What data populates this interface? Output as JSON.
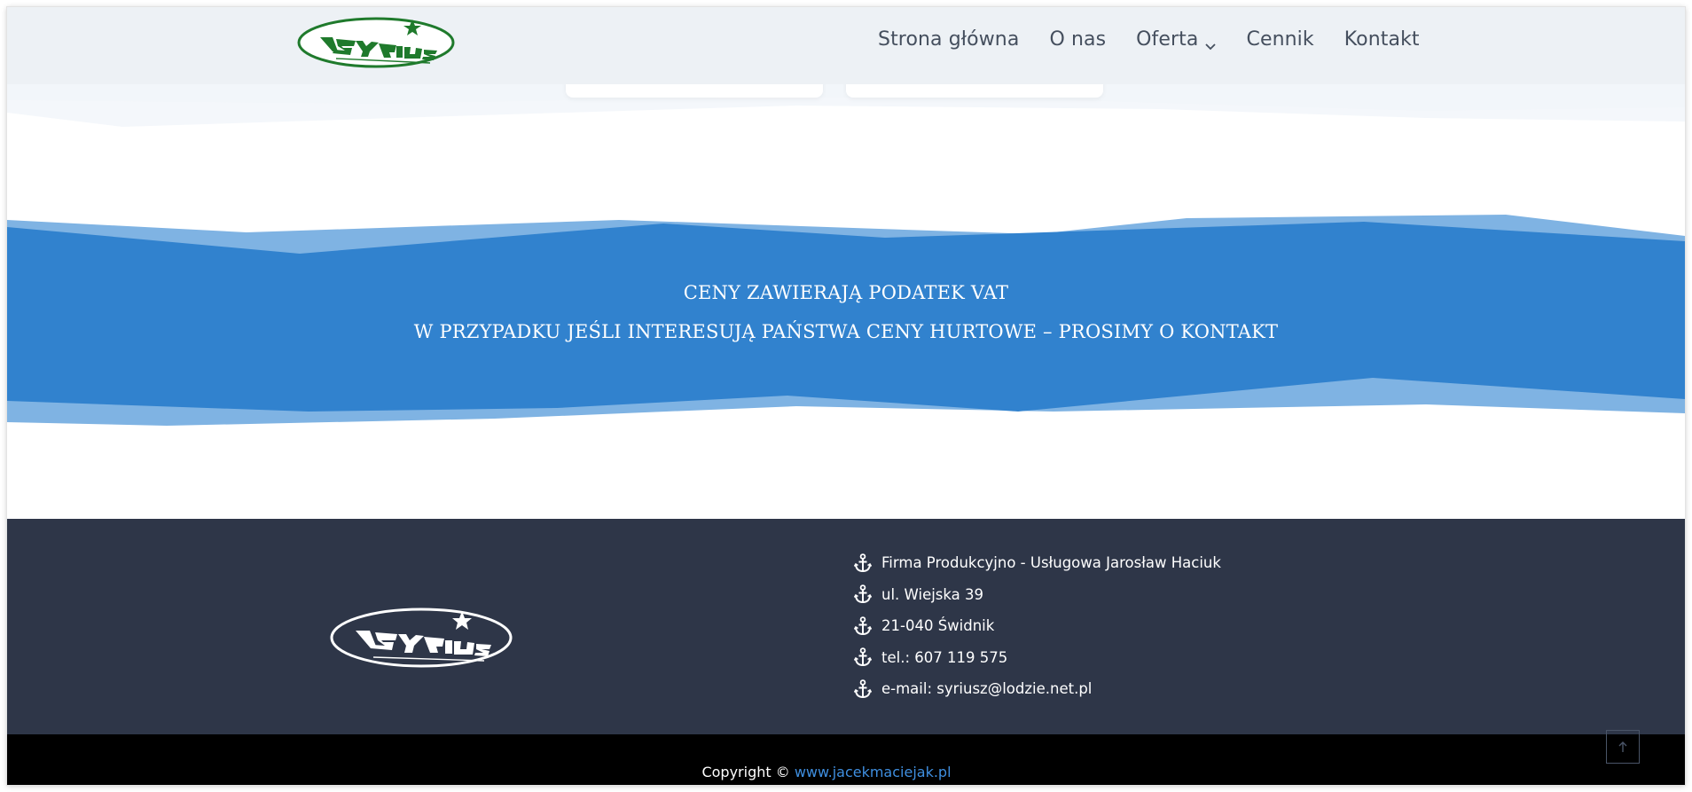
{
  "brand": {
    "logo_text": "SYRIUSZ",
    "green": "#1f7a2c",
    "blue": "#3182ce"
  },
  "nav": {
    "items": [
      {
        "label": "Strona główna"
      },
      {
        "label": "O nas"
      },
      {
        "label": "Oferta",
        "has_dropdown": true
      },
      {
        "label": "Cennik"
      },
      {
        "label": "Kontakt"
      }
    ]
  },
  "band": {
    "line1": "CENY ZAWIERAJĄ PODATEK VAT",
    "line2": "W PRZYPADKU JEŚLI INTERESUJĄ PAŃSTWA CENY HURTOWE – PROSIMY O KONTAKT"
  },
  "footer": {
    "contact_icon": "anchor-icon",
    "contacts": [
      "Firma Produkcyjno - Usługowa Jarosław Haciuk",
      "ul. Wiejska 39",
      "21-040 Świdnik",
      "tel.: 607 119 575",
      "e-mail: syriusz@lodzie.net.pl"
    ]
  },
  "bottom": {
    "copyright_prefix": "Copyright ©",
    "link_text": "www.jacekmaciejak.pl",
    "scroll_top_icon": "arrow-up-icon"
  }
}
